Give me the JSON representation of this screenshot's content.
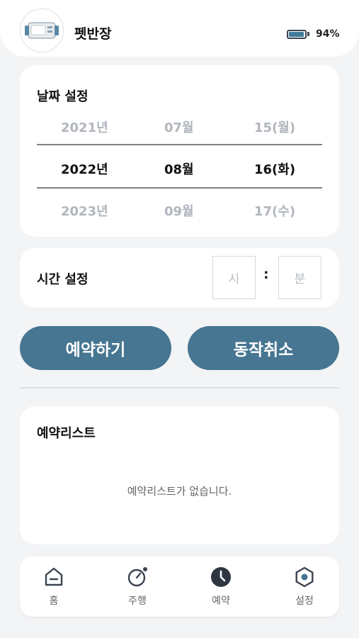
{
  "header": {
    "device_name": "펫반장",
    "battery_percent_text": "94%",
    "battery_level": 0.94
  },
  "date_card": {
    "title": "날짜 설정",
    "rows": [
      {
        "year": "2021년",
        "month": "07월",
        "day": "15(월)"
      },
      {
        "year": "2022년",
        "month": "08월",
        "day": "16(화)"
      },
      {
        "year": "2023년",
        "month": "09월",
        "day": "17(수)"
      }
    ]
  },
  "time_card": {
    "title": "시간 설정",
    "hour_placeholder": "시",
    "separator": ":",
    "minute_placeholder": "분"
  },
  "actions": {
    "reserve_label": "예약하기",
    "cancel_label": "동작취소"
  },
  "reservation_list": {
    "title": "예약리스트",
    "empty_message": "예약리스트가 없습니다."
  },
  "bottom_nav": {
    "items": [
      {
        "label": "홈",
        "icon": "home-icon"
      },
      {
        "label": "주행",
        "icon": "drive-icon"
      },
      {
        "label": "예약",
        "icon": "clock-icon"
      },
      {
        "label": "설정",
        "icon": "settings-icon"
      }
    ]
  },
  "colors": {
    "accent": "#467691",
    "background": "#f3f4f6",
    "card": "#ffffff"
  }
}
